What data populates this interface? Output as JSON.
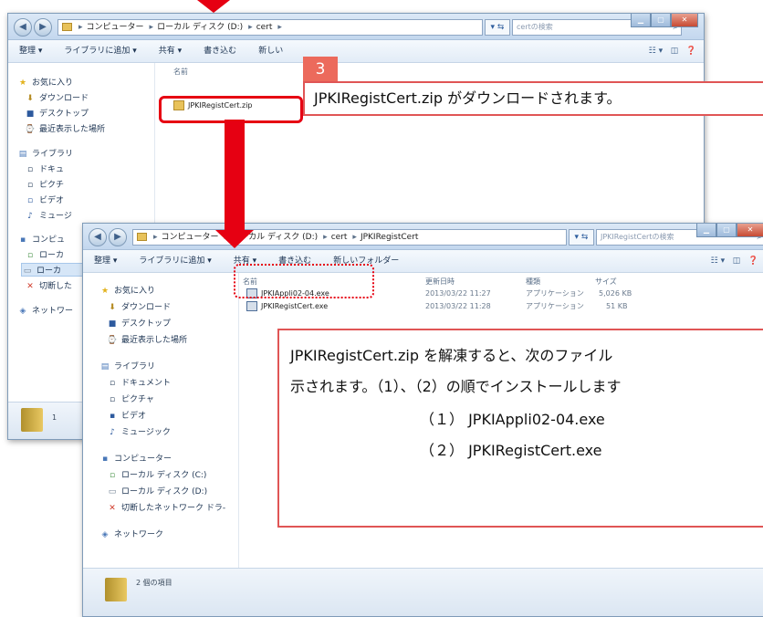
{
  "back_window": {
    "address": [
      "コンピューター",
      "ローカル ディスク (D:)",
      "cert"
    ],
    "search_placeholder": "certの検索",
    "toolbar": [
      "整理 ▾",
      "ライブラリに追加 ▾",
      "共有 ▾",
      "書き込む",
      "新しい"
    ],
    "nav": [
      {
        "icon": "★",
        "label": "お気に入り"
      },
      {
        "icon": "⬇",
        "label": "ダウンロード"
      },
      {
        "icon": "■",
        "label": "デスクトップ"
      },
      {
        "icon": "⌚",
        "label": "最近表示した場所"
      },
      {
        "icon": "▤",
        "label": "ライブラリ"
      },
      {
        "icon": "▫",
        "label": "ドキュ"
      },
      {
        "icon": "▫",
        "label": "ピクチ"
      },
      {
        "icon": "▫",
        "label": "ビデオ"
      },
      {
        "icon": "♪",
        "label": "ミュージ"
      },
      {
        "icon": "▪",
        "label": "コンピュ"
      },
      {
        "icon": "▫",
        "label": "ローカ"
      },
      {
        "icon": "▭",
        "label": "ローカ"
      },
      {
        "icon": "✕",
        "label": "切断した"
      },
      {
        "icon": "◈",
        "label": "ネットワー"
      }
    ],
    "column_name": "名前",
    "file": "JPKIRegistCert.zip",
    "status_count": "1"
  },
  "front_window": {
    "address": [
      "コンピューター",
      "ローカル ディスク (D:)",
      "cert",
      "JPKIRegistCert"
    ],
    "search_placeholder": "JPKIRegistCertの検索",
    "toolbar": [
      "整理 ▾",
      "ライブラリに追加 ▾",
      "共有 ▾",
      "書き込む",
      "新しいフォルダー"
    ],
    "nav": [
      {
        "icon": "★",
        "label": "お気に入り"
      },
      {
        "icon": "⬇",
        "label": "ダウンロード"
      },
      {
        "icon": "■",
        "label": "デスクトップ"
      },
      {
        "icon": "⌚",
        "label": "最近表示した場所"
      },
      {
        "icon": "▤",
        "label": "ライブラリ"
      },
      {
        "icon": "▫",
        "label": "ドキュメント"
      },
      {
        "icon": "▫",
        "label": "ピクチャ"
      },
      {
        "icon": "▪",
        "label": "ビデオ"
      },
      {
        "icon": "♪",
        "label": "ミュージック"
      },
      {
        "icon": "▪",
        "label": "コンピューター"
      },
      {
        "icon": "▫",
        "label": "ローカル ディスク (C:)"
      },
      {
        "icon": "▭",
        "label": "ローカル ディスク (D:)"
      },
      {
        "icon": "✕",
        "label": "切断したネットワーク ドラ-"
      },
      {
        "icon": "◈",
        "label": "ネットワーク"
      }
    ],
    "columns": [
      "名前",
      "更新日時",
      "種類",
      "サイズ"
    ],
    "files": [
      {
        "name": "JPKIAppli02-04.exe",
        "date": "2013/03/22 11:27",
        "type": "アプリケーション",
        "size": "5,026 KB"
      },
      {
        "name": "JPKIRegistCert.exe",
        "date": "2013/03/22 11:28",
        "type": "アプリケーション",
        "size": "51 KB"
      }
    ],
    "status": "2 個の項目"
  },
  "step_badge": "3",
  "callout_download": "JPKIRegistCert.zip がダウンロードされます。",
  "callout_unzip": {
    "line1": "JPKIRegistCert.zip  を解凍すると、次のファイル",
    "line2": "示されます。（1）、（2）の順でインストールします",
    "item1": "（１） JPKIAppli02-04.exe",
    "item2": "（２） JPKIRegistCert.exe"
  },
  "colors": {
    "accent_red": "#e60012",
    "callout_border": "#e05555",
    "badge_bg": "#ec6a5c"
  }
}
